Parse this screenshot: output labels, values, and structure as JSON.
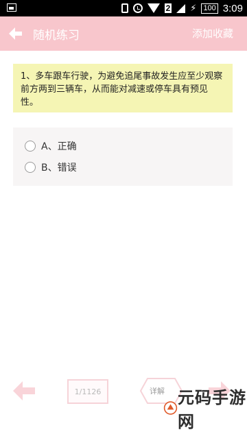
{
  "status_bar": {
    "sim_slot": "2",
    "battery": "100",
    "time": "3:09"
  },
  "app_bar": {
    "title": "随机练习",
    "favorite_label": "添加收藏",
    "color": "#f8c6cc"
  },
  "question": {
    "text": "1、多车跟车行驶，为避免追尾事故发生应至少观察前方两到三辆车，从而能对减速或停车具有预见性。",
    "background": "#f5f5b4"
  },
  "options": [
    {
      "label": "A、正确",
      "selected": false
    },
    {
      "label": "B、错误",
      "selected": false
    }
  ],
  "bottom_bar": {
    "progress": "1/1126",
    "detail_label": "详解"
  },
  "watermark": {
    "text": "元码手游网"
  },
  "icons": [
    "photo-icon",
    "vibrate-icon",
    "alarm-icon",
    "wifi-icon",
    "signal-icon",
    "charging-icon",
    "back-arrow-icon",
    "prev-arrow-icon",
    "next-arrow-icon"
  ]
}
